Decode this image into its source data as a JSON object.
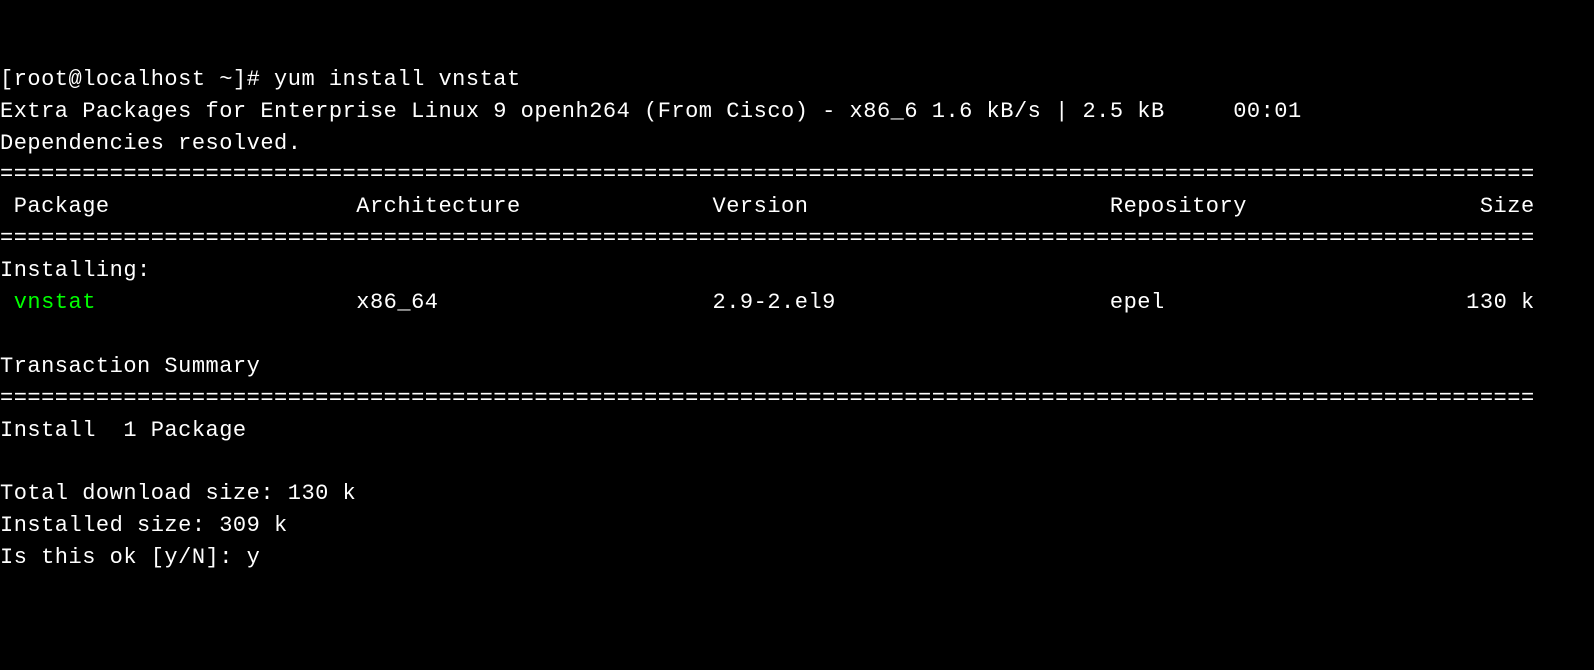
{
  "prompt": "[root@localhost ~]# ",
  "command": "yum install vnstat",
  "repo_line": "Extra Packages for Enterprise Linux 9 openh264 (From Cisco) - x86_6 1.6 kB/s | 2.5 kB     00:01",
  "deps_line": "Dependencies resolved.",
  "hr": "================================================================================================================",
  "headers": {
    "package": " Package",
    "arch": "Architecture",
    "version": "Version",
    "repo": "Repository",
    "size": "Size"
  },
  "installing_label": "Installing:",
  "row": {
    "package": " vnstat",
    "arch": "x86_64",
    "version": "2.9-2.el9",
    "repo": "epel",
    "size": "130 k"
  },
  "txn_summary": "Transaction Summary",
  "install_count": "Install  1 Package",
  "download_size": "Total download size: 130 k",
  "installed_size": "Installed size: 309 k",
  "confirm_prompt": "Is this ok [y/N]: ",
  "confirm_answer": "y"
}
